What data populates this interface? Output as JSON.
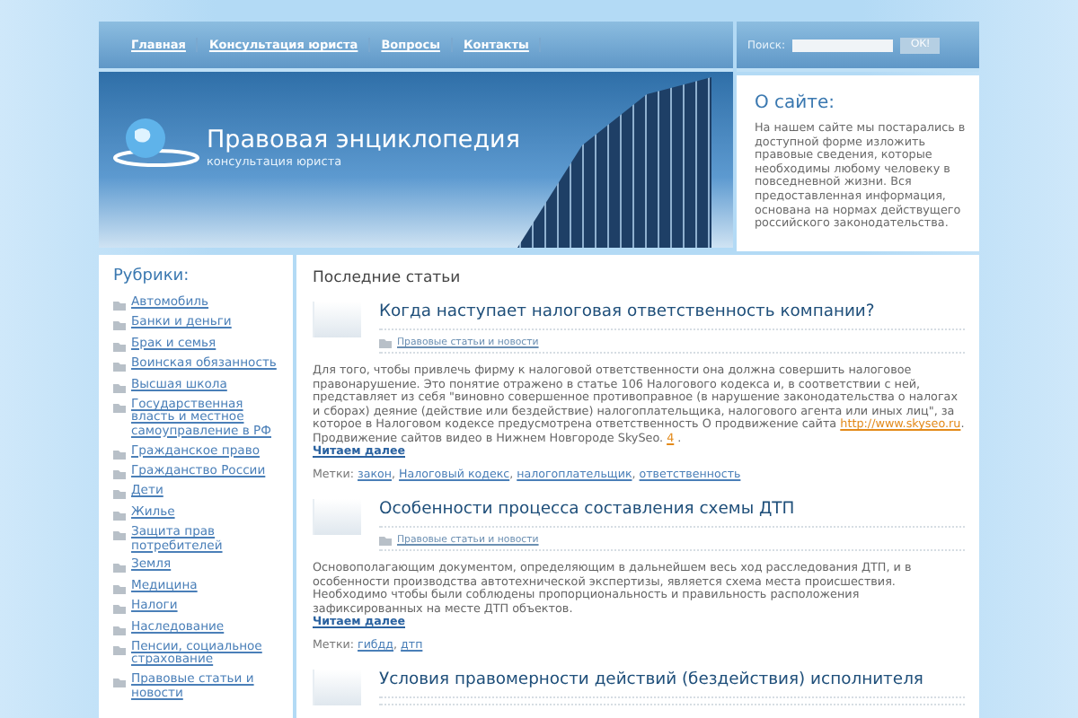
{
  "nav": {
    "items": [
      {
        "label": "Главная"
      },
      {
        "label": "Консультация юриста"
      },
      {
        "label": "Вопросы"
      },
      {
        "label": "Контакты"
      }
    ]
  },
  "search": {
    "label": "Поиск:",
    "button": "OK!"
  },
  "header": {
    "title": "Правовая энциклопедия",
    "subtitle": "консультация юриста"
  },
  "about": {
    "title": "О сайте:",
    "text": "На нашем сайте мы постарались в доступной форме изложить правовые сведения, которые необходимы любому человеку в повседневной жизни. Вся предоставленная информация, основана на нормах действущего российского законодательства."
  },
  "sidebar": {
    "title": "Рубрики:",
    "items": [
      {
        "label": "Автомобиль"
      },
      {
        "label": "Банки и деньги"
      },
      {
        "label": "Брак и семья"
      },
      {
        "label": "Воинская обязанность"
      },
      {
        "label": "Высшая школа"
      },
      {
        "label": "Государственная власть и местное самоуправление в РФ"
      },
      {
        "label": "Гражданское право"
      },
      {
        "label": "Гражданство России"
      },
      {
        "label": "Дети"
      },
      {
        "label": "Жилье"
      },
      {
        "label": "Защита прав потребителей"
      },
      {
        "label": "Земля"
      },
      {
        "label": "Медицина"
      },
      {
        "label": "Налоги"
      },
      {
        "label": "Наследование"
      },
      {
        "label": "Пенсии, социальное страхование"
      },
      {
        "label": "Правовые статьи и новости"
      }
    ]
  },
  "content": {
    "heading": "Последние статьи",
    "posts": [
      {
        "title": "Когда наступает налоговая ответственность компании?",
        "category": "Правовые статьи и новости",
        "excerpt": "Для того, чтобы привлечь фирму к налоговой ответственности она должна совершить налоговое правонарушение. Это понятие отражено в статье 106 Налогового кодекса и, в соответствии с ней, представляет из себя \"виновно совершенное противоправное (в нарушение законодательства о налогах и сборах) деяние (действие или бездействие) налогоплательщика, налогового агента или иных лиц\", за которое в Налоговом кодексе предусмотрена ответственность О продвижение сайта",
        "link": "http://www.skyseo.ru",
        "excerpt_end": ". Продвижение сайтов видео в Нижнем Новгороде SkySeo.",
        "footnote": "4",
        "excerpt_tail": ".",
        "more": "Читаем далее",
        "tags_label": "Метки:",
        "tag_separator": ",",
        "tags": [
          "закон",
          "Налоговый кодекс",
          "налогоплательщик",
          "ответственность"
        ]
      },
      {
        "title": "Особенности процесса составления схемы ДТП",
        "category": "Правовые статьи и новости",
        "excerpt": "Основополагающим документом, определяющим в дальнейшем весь ход расследования ДТП, и в особенности производства автотехнической экспертизы, является схема места происшествия. Необходимо чтобы были соблюдены пропорциональность и правильность расположения зафиксированных на месте ДТП объектов.",
        "more": "Читаем далее",
        "tags_label": "Метки:",
        "tag_separator": ",",
        "tags": [
          "гибдд",
          "дтп"
        ]
      },
      {
        "title": "Условия правомерности действий (бездействия) исполнителя"
      }
    ]
  }
}
